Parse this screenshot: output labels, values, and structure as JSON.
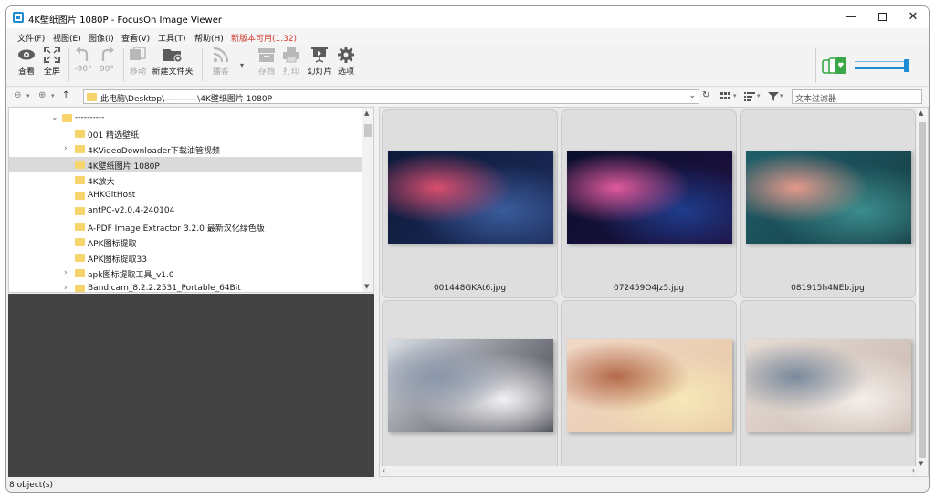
{
  "window": {
    "title": "4K壁纸图片 1080P - FocusOn Image Viewer",
    "min_symbol": "—",
    "close_symbol": "✕"
  },
  "menu": {
    "items": [
      "文件(F)",
      "视图(E)",
      "图像(I)",
      "查看(V)",
      "工具(T)",
      "帮助(H)"
    ],
    "update_notice": "新版本可用(1.32)"
  },
  "toolbar": {
    "view_label": "查看",
    "fullscreen_label": "全屏",
    "rotate_left_label": "-90°",
    "rotate_right_label": "90°",
    "move_label": "移动",
    "new_folder_label": "新建文件夹",
    "broadcast_label": "播客",
    "save_label": "存档",
    "print_label": "打印",
    "slideshow_label": "幻灯片",
    "options_label": "选项"
  },
  "address": {
    "path": "此电脑\\Desktop\\————\\4K壁纸图片 1080P",
    "filter_placeholder": "文本过滤器"
  },
  "tree": {
    "items": [
      {
        "label": "----------",
        "expander": "⌄",
        "indent": 1
      },
      {
        "label": "001 精选壁纸",
        "expander": "",
        "indent": 2
      },
      {
        "label": "4KVideoDownloader下载油管视频",
        "expander": "›",
        "indent": 2
      },
      {
        "label": "4K壁纸图片 1080P",
        "expander": "",
        "indent": 2,
        "selected": true
      },
      {
        "label": "4K放大",
        "expander": "",
        "indent": 2
      },
      {
        "label": "AHKGitHost",
        "expander": "",
        "indent": 2
      },
      {
        "label": "antPC-v2.0.4-240104",
        "expander": "",
        "indent": 2
      },
      {
        "label": "A-PDF Image Extractor 3.2.0 最新汉化绿色版",
        "expander": "",
        "indent": 2
      },
      {
        "label": "APK图标提取",
        "expander": "",
        "indent": 2
      },
      {
        "label": "APK图标提取33",
        "expander": "",
        "indent": 2
      },
      {
        "label": "apk图标提取工具_v1.0",
        "expander": "›",
        "indent": 2
      },
      {
        "label": "Bandicam_8.2.2.2531_Portable_64Bit",
        "expander": "›",
        "indent": 2
      }
    ]
  },
  "thumbnails": [
    {
      "name": "001448GKAt6.jpg",
      "colors": [
        "#0d1a3a",
        "#3a5c9c",
        "#d94e6e",
        "#1d2b5a"
      ]
    },
    {
      "name": "072459O4Jz5.jpg",
      "colors": [
        "#0a0f2e",
        "#1e3c8c",
        "#e05a9c",
        "#201040"
      ]
    },
    {
      "name": "081915h4NEb.jpg",
      "colors": [
        "#1f5f6a",
        "#3b8c8c",
        "#e49a8c",
        "#163c44"
      ]
    },
    {
      "name": "",
      "colors": [
        "#d9dde4",
        "#f2f2f4",
        "#8a96aa",
        "#3a3a44"
      ]
    },
    {
      "name": "",
      "colors": [
        "#f0d8c8",
        "#f6e8b8",
        "#b46a4a",
        "#e8c8a4"
      ]
    },
    {
      "name": "",
      "colors": [
        "#e6dcd4",
        "#f4ede8",
        "#7a8a9c",
        "#c8b8b0"
      ]
    }
  ],
  "status": {
    "text": "8 object(s)"
  },
  "colors": {
    "accent": "#1b8bd4",
    "update_red": "#d33a2c",
    "folder": "#f6d36b",
    "selection": "#dadada"
  }
}
